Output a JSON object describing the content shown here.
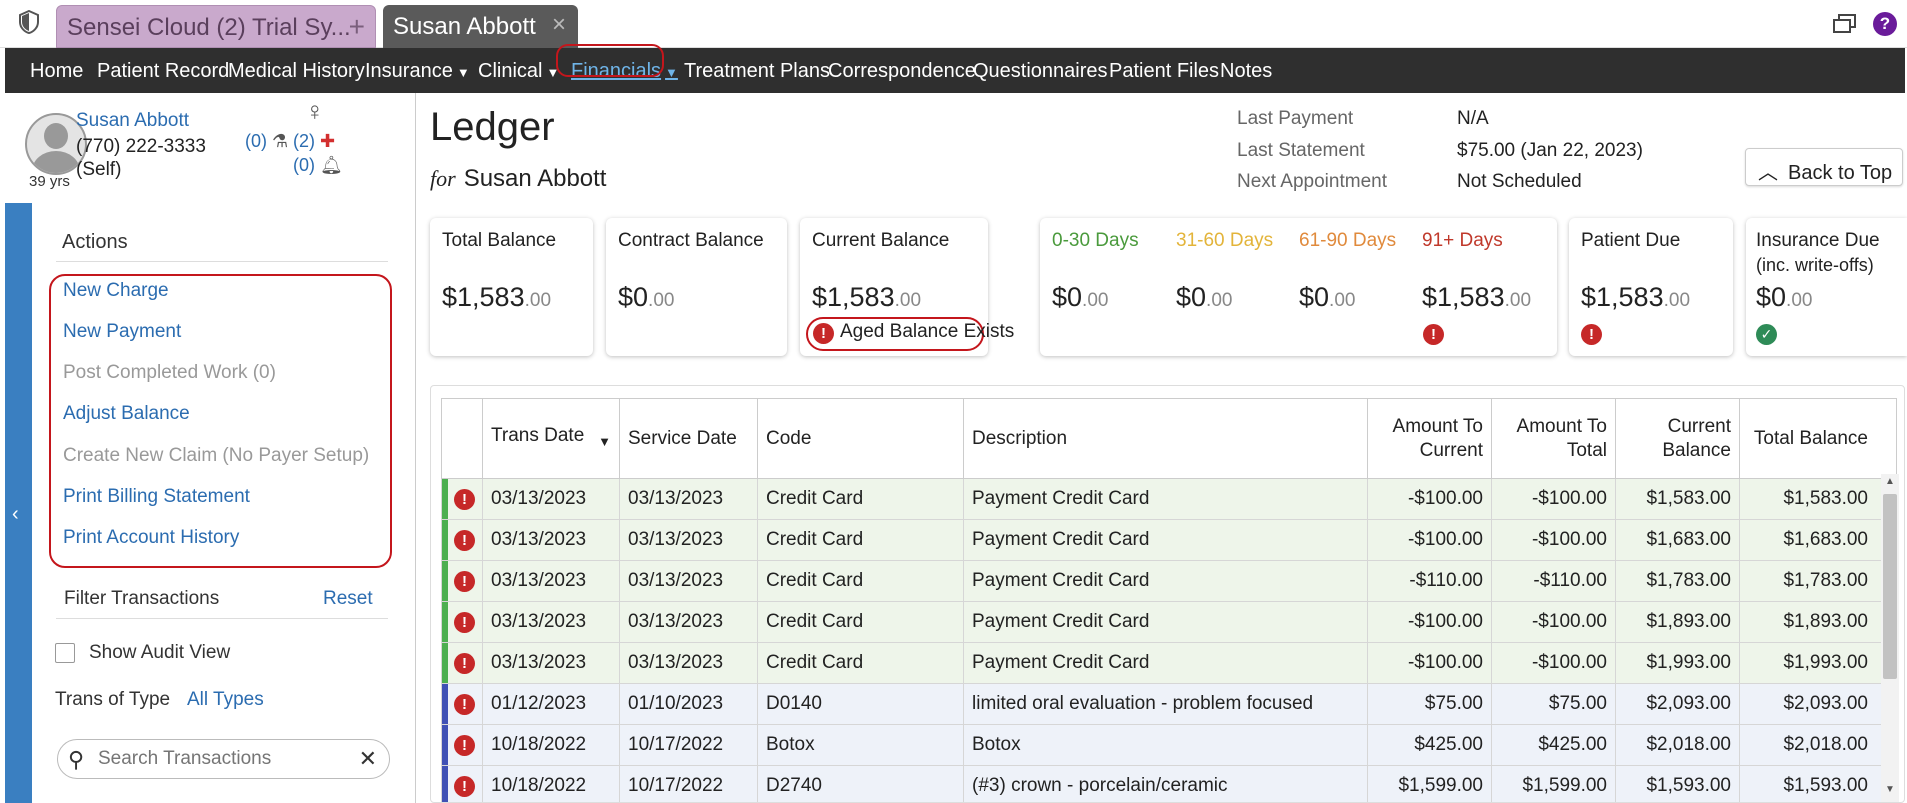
{
  "tabs": [
    {
      "label": "Sensei Cloud (2) Trial Sy...",
      "add": "+"
    },
    {
      "label": "Susan Abbott",
      "close": "×"
    }
  ],
  "nav": [
    {
      "label": "Home"
    },
    {
      "label": "Patient Record"
    },
    {
      "label": "Medical History"
    },
    {
      "label": "Insurance",
      "dropdown": true
    },
    {
      "label": "Clinical",
      "dropdown": true
    },
    {
      "label": "Financials",
      "dropdown": true,
      "active": true
    },
    {
      "label": "Treatment Plans"
    },
    {
      "label": "Correspondence"
    },
    {
      "label": "Questionnaires"
    },
    {
      "label": "Patient Files"
    },
    {
      "label": "Notes"
    }
  ],
  "patient": {
    "name": "Susan Abbott",
    "phone": "(770) 222-3333",
    "relation": "(Self)",
    "age": "39 yrs",
    "lab_count": "(0)",
    "medical_count": "(2)",
    "alert_count": "(0)"
  },
  "sidebar": {
    "actions_title": "Actions",
    "actions": [
      {
        "label": "New Charge",
        "enabled": true
      },
      {
        "label": "New Payment",
        "enabled": true
      },
      {
        "label": "Post Completed Work (0)",
        "enabled": false
      },
      {
        "label": "Adjust Balance",
        "enabled": true
      },
      {
        "label": "Create New Claim (No Payer Setup)",
        "enabled": false
      },
      {
        "label": "Print Billing Statement",
        "enabled": true
      },
      {
        "label": "Print Account History",
        "enabled": true
      }
    ],
    "filter_title": "Filter Transactions",
    "reset": "Reset",
    "show_audit": "Show Audit View",
    "trans_type_label": "Trans of Type",
    "trans_type_value": "All Types",
    "search_placeholder": "Search Transactions"
  },
  "ledger": {
    "title": "Ledger",
    "for_label": "for",
    "patient": "Susan Abbott",
    "last_payment_label": "Last Payment",
    "last_payment": "N/A",
    "last_statement_label": "Last Statement",
    "last_statement": "$75.00 (Jan 22, 2023)",
    "next_appt_label": "Next Appointment",
    "next_appt": "Not Scheduled",
    "back_to_top": "Back to Top"
  },
  "cards": {
    "total": {
      "label": "Total Balance",
      "dollars": "$1,583",
      "cents": ".00"
    },
    "contract": {
      "label": "Contract Balance",
      "dollars": "$0",
      "cents": ".00"
    },
    "current": {
      "label": "Current Balance",
      "dollars": "$1,583",
      "cents": ".00",
      "note": "Aged Balance Exists"
    },
    "aging": [
      {
        "label": "0-30 Days",
        "dollars": "$0",
        "cents": ".00",
        "color": "#4a9a3c"
      },
      {
        "label": "31-60 Days",
        "dollars": "$0",
        "cents": ".00",
        "color": "#e3b43a"
      },
      {
        "label": "61-90 Days",
        "dollars": "$0",
        "cents": ".00",
        "color": "#e08a3c"
      },
      {
        "label": "91+ Days",
        "dollars": "$1,583",
        "cents": ".00",
        "color": "#c0392b"
      }
    ],
    "patient_due": {
      "label": "Patient Due",
      "dollars": "$1,583",
      "cents": ".00"
    },
    "insurance_due": {
      "label": "Insurance Due",
      "sublabel": "(inc. write-offs)",
      "dollars": "$0",
      "cents": ".00"
    }
  },
  "table": {
    "headers": [
      "Trans Date",
      "Service Date",
      "Code",
      "Description",
      "Amount To Current",
      "Amount To Total",
      "Current Balance",
      "Total Balance"
    ],
    "rows": [
      {
        "type": "payment",
        "trans_date": "03/13/2023",
        "service_date": "03/13/2023",
        "code": "Credit Card",
        "description": "Payment Credit Card",
        "to_current": "-$100.00",
        "to_total": "-$100.00",
        "current": "$1,583.00",
        "total": "$1,583.00"
      },
      {
        "type": "payment",
        "trans_date": "03/13/2023",
        "service_date": "03/13/2023",
        "code": "Credit Card",
        "description": "Payment Credit Card",
        "to_current": "-$100.00",
        "to_total": "-$100.00",
        "current": "$1,683.00",
        "total": "$1,683.00"
      },
      {
        "type": "payment",
        "trans_date": "03/13/2023",
        "service_date": "03/13/2023",
        "code": "Credit Card",
        "description": "Payment Credit Card",
        "to_current": "-$110.00",
        "to_total": "-$110.00",
        "current": "$1,783.00",
        "total": "$1,783.00"
      },
      {
        "type": "payment",
        "trans_date": "03/13/2023",
        "service_date": "03/13/2023",
        "code": "Credit Card",
        "description": "Payment Credit Card",
        "to_current": "-$100.00",
        "to_total": "-$100.00",
        "current": "$1,893.00",
        "total": "$1,893.00"
      },
      {
        "type": "payment",
        "trans_date": "03/13/2023",
        "service_date": "03/13/2023",
        "code": "Credit Card",
        "description": "Payment Credit Card",
        "to_current": "-$100.00",
        "to_total": "-$100.00",
        "current": "$1,993.00",
        "total": "$1,993.00"
      },
      {
        "type": "charge",
        "trans_date": "01/12/2023",
        "service_date": "01/10/2023",
        "code": "D0140",
        "description": "limited oral evaluation - problem focused",
        "to_current": "$75.00",
        "to_total": "$75.00",
        "current": "$2,093.00",
        "total": "$2,093.00"
      },
      {
        "type": "charge",
        "trans_date": "10/18/2022",
        "service_date": "10/17/2022",
        "code": "Botox",
        "description": "Botox",
        "to_current": "$425.00",
        "to_total": "$425.00",
        "current": "$2,018.00",
        "total": "$2,018.00"
      },
      {
        "type": "charge",
        "trans_date": "10/18/2022",
        "service_date": "10/17/2022",
        "code": "D2740",
        "description": "(#3) crown - porcelain/ceramic",
        "to_current": "$1,599.00",
        "to_total": "$1,599.00",
        "current": "$1,593.00",
        "total": "$1,593.00"
      }
    ]
  },
  "colors": {
    "accent": "#2b6cb0",
    "nav_bg": "#2f2f2f",
    "payment_bar": "#4caf50",
    "charge_bar": "#3f51b5",
    "alert": "#c62828",
    "highlight": "#c4161c"
  }
}
